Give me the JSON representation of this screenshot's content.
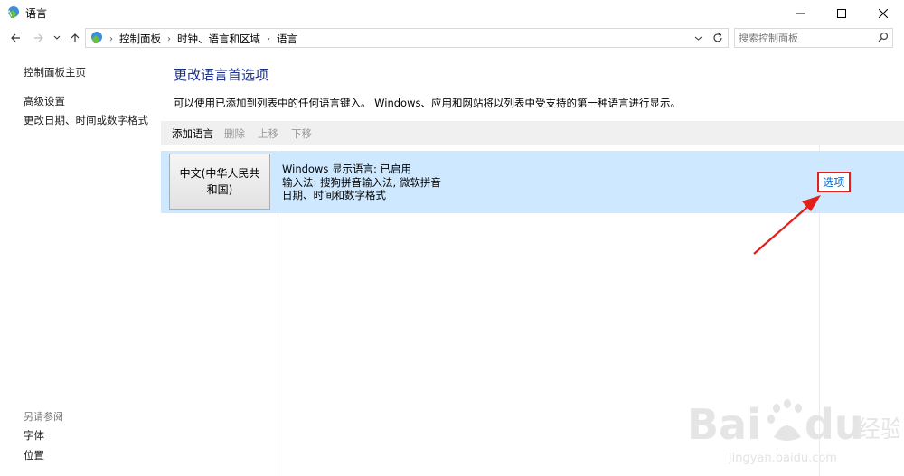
{
  "window": {
    "title": "语言",
    "minimize_label": "Minimize",
    "maximize_label": "Maximize",
    "close_label": "Close"
  },
  "address": {
    "breadcrumbs": [
      "控制面板",
      "时钟、语言和区域",
      "语言"
    ],
    "search_placeholder": "搜索控制面板"
  },
  "sidebar": {
    "home": "控制面板主页",
    "links": [
      "高级设置",
      "更改日期、时间或数字格式"
    ],
    "see_also_label": "另请参阅",
    "see_also": [
      "字体",
      "位置"
    ]
  },
  "main": {
    "heading": "更改语言首选项",
    "description": "可以使用已添加到列表中的任何语言键入。 Windows、应用和网站将以列表中受支持的第一种语言进行显示。",
    "toolbar": {
      "add": "添加语言",
      "remove": "删除",
      "up": "上移",
      "down": "下移"
    },
    "language": {
      "name": "中文(中华人民共和国)",
      "line1": "Windows 显示语言: 已启用",
      "line2": "输入法: 搜狗拼音输入法, 微软拼音",
      "line3": "日期、时间和数字格式",
      "options_link": "选项"
    }
  },
  "watermark": {
    "text": "jingyan.baidu.com"
  },
  "colors": {
    "heading": "#1e3287",
    "row_selected": "#cde8ff",
    "link": "#0066cc",
    "annotation": "#e0201b"
  }
}
